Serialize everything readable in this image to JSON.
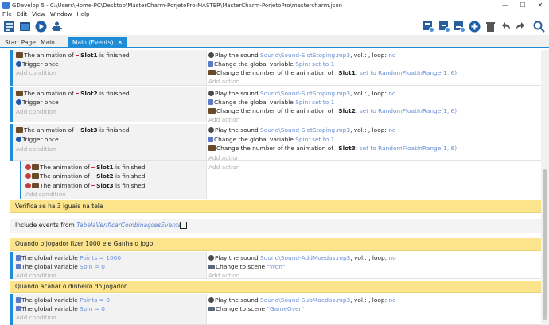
{
  "window": {
    "title": "GDevelop 5 - C:\\Users\\Home-PC\\Desktop\\MasterCharm-PorjetoPro-MASTER\\MasterCharm-PorjetoPro\\mastercharm.json",
    "minimize": "—",
    "maximize": "☐",
    "close": "✕"
  },
  "menu": [
    "File",
    "Edit",
    "View",
    "Window",
    "Help"
  ],
  "tabs": [
    {
      "label": "Start Page"
    },
    {
      "label": "Main"
    },
    {
      "label": "Main (Events)",
      "close": "✕"
    }
  ],
  "events": [
    {
      "conditions": [
        {
          "parts": [
            "The animation of ",
            "Slot1",
            " is finished"
          ]
        },
        {
          "parts": [
            "Trigger once"
          ]
        }
      ],
      "add_condition": "Add condition",
      "actions": [
        {
          "parts": [
            "Play the sound ",
            "Sound\\Sound-SlotStoping.mp3",
            ", vol.: ",
            ", loop: ",
            "no"
          ]
        },
        {
          "parts": [
            "Change the global variable ",
            "Spin",
            ": set to ",
            "1"
          ]
        },
        {
          "parts": [
            "Change the number of the animation of ",
            "Slot1",
            ": set to ",
            "RandomFloatInRange(1, 6)"
          ]
        }
      ],
      "add_action": "Add action"
    },
    {
      "conditions": [
        {
          "parts": [
            "The animation of ",
            "Slot2",
            " is finished"
          ]
        },
        {
          "parts": [
            "Trigger once"
          ]
        }
      ],
      "add_condition": "Add condition",
      "actions": [
        {
          "parts": [
            "Play the sound ",
            "Sound\\Sound-SlotStoping.mp3",
            ", vol.: ",
            ", loop: ",
            "no"
          ]
        },
        {
          "parts": [
            "Change the global variable ",
            "Spin",
            ": set to ",
            "1"
          ]
        },
        {
          "parts": [
            "Change the number of the animation of ",
            "Slot2",
            ": set to ",
            "RandomFloatInRange(1, 6)"
          ]
        }
      ],
      "add_action": "Add action"
    },
    {
      "conditions": [
        {
          "parts": [
            "The animation of ",
            "Slot3",
            " is finished"
          ]
        },
        {
          "parts": [
            "Trigger once"
          ]
        }
      ],
      "add_condition": "Add condition",
      "actions": [
        {
          "parts": [
            "Play the sound ",
            "Sound\\Sound-SlotStoping.mp3",
            ", vol.: ",
            ", loop: ",
            "no"
          ]
        },
        {
          "parts": [
            "Change the global variable ",
            "Spin",
            ": set to ",
            "1"
          ]
        },
        {
          "parts": [
            "Change the number of the animation of ",
            "Slot3",
            ": set to ",
            "RandomFloatInRange(1, 6)"
          ]
        }
      ],
      "add_action": "Add action"
    },
    {
      "conditions": [
        {
          "parts": [
            "The animation of ",
            "Slot1",
            " is finished"
          ]
        },
        {
          "parts": [
            "The animation of ",
            "Slot2",
            " is finished"
          ]
        },
        {
          "parts": [
            "The animation of ",
            "Slot3",
            " is finished"
          ]
        }
      ],
      "add_condition": "Add condition",
      "actions": [],
      "add_action": "Add action"
    }
  ],
  "comment1": "Verifica se ha 3 iguais na tela",
  "include": {
    "prefix": "Include events from ",
    "external": "TabelaVerificarCombinaçoesEvents"
  },
  "comment2": "Quando o jogador fizer 1000 ele Ganha o jogo",
  "win_event": {
    "conditions": [
      {
        "parts": [
          "The global variable ",
          "Points",
          " = ",
          "1000"
        ]
      },
      {
        "parts": [
          "The global variable ",
          "Spin",
          " = ",
          "0"
        ]
      }
    ],
    "add_condition": "Add condition",
    "actions": [
      {
        "parts": [
          "Play the sound ",
          "Sound\\Sound-AddMoedas.mp3",
          ", vol.: ",
          ", loop: ",
          "no"
        ]
      },
      {
        "parts": [
          "Change to scene ",
          "\"Won\""
        ]
      }
    ],
    "add_action": "Add action"
  },
  "comment3": "Quando acabar o dinheiro do jogador",
  "lose_event": {
    "conditions": [
      {
        "parts": [
          "The global variable ",
          "Points",
          " = ",
          "0"
        ]
      },
      {
        "parts": [
          "The global variable ",
          "Spin",
          " = ",
          "0"
        ]
      }
    ],
    "add_condition": "Add condition",
    "actions": [
      {
        "parts": [
          "Play the sound ",
          "Sound\\Sound-SubMoedas.mp3",
          ", vol.: ",
          ", loop: ",
          "no"
        ]
      },
      {
        "parts": [
          "Change to scene ",
          "\"GameOver\""
        ]
      }
    ]
  },
  "colors": {
    "accent": "#1e8cd6",
    "comment": "#fbe48c",
    "param": "#5b7fd1"
  }
}
